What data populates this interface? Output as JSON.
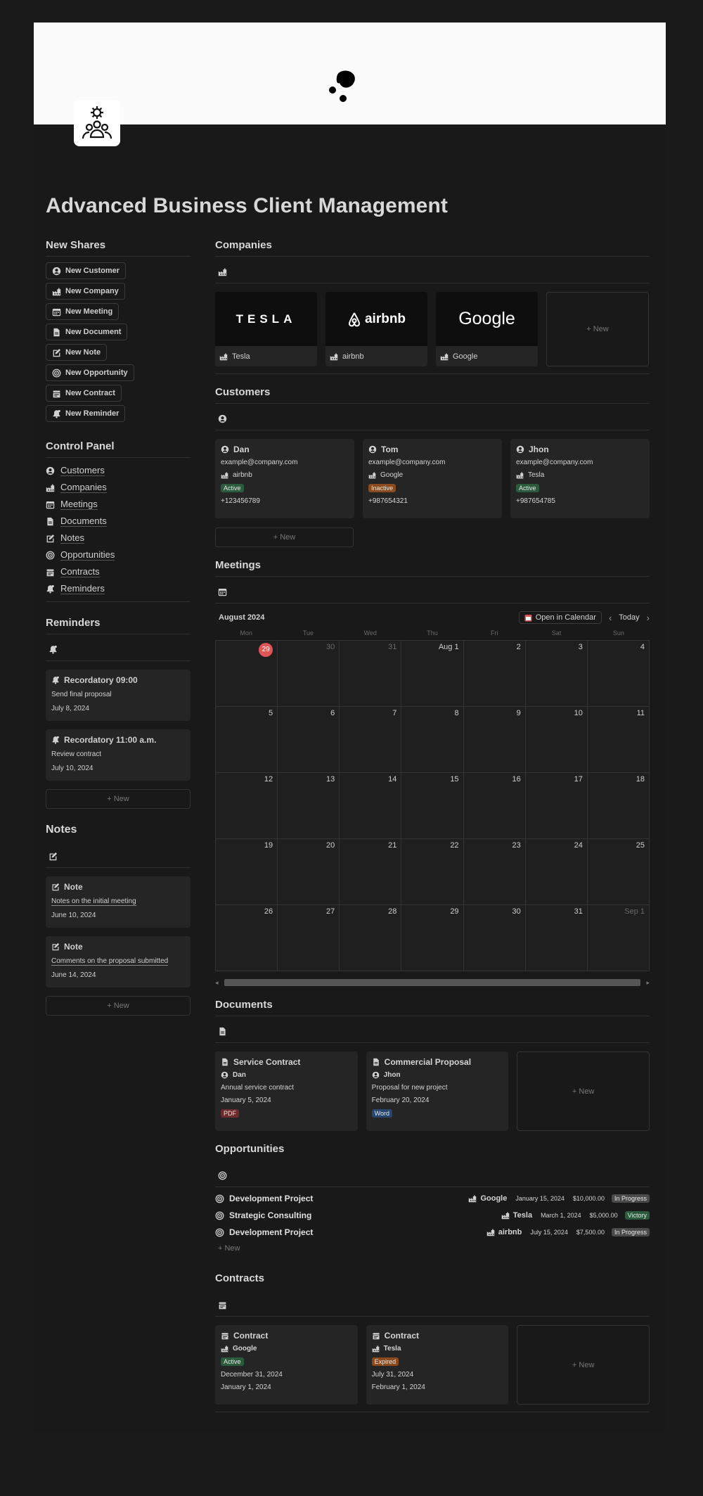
{
  "page": {
    "title": "Advanced Business Client Management"
  },
  "new_shares": {
    "heading": "New Shares",
    "buttons": [
      {
        "label": "New Customer",
        "icon": "person-circle-icon"
      },
      {
        "label": "New Company",
        "icon": "factory-icon"
      },
      {
        "label": "New Meeting",
        "icon": "calendar-icon"
      },
      {
        "label": "New Document",
        "icon": "document-icon"
      },
      {
        "label": "New Note",
        "icon": "note-edit-icon"
      },
      {
        "label": "New Opportunity",
        "icon": "target-icon"
      },
      {
        "label": "New Contract",
        "icon": "contract-icon"
      },
      {
        "label": "New Reminder",
        "icon": "bell-icon"
      }
    ]
  },
  "control_panel": {
    "heading": "Control Panel",
    "items": [
      "Customers",
      "Companies",
      "Meetings",
      "Documents",
      "Notes",
      "Opportunities",
      "Contracts",
      "Reminders"
    ]
  },
  "reminders": {
    "heading": "Reminders",
    "items": [
      {
        "title": "Recordatory 09:00",
        "text": "Send final proposal",
        "date": "July 8, 2024"
      },
      {
        "title": "Recordatory 11:00 a.m.",
        "text": "Review contract",
        "date": "July 10, 2024"
      }
    ],
    "new_label": "New"
  },
  "notes": {
    "heading": "Notes",
    "items": [
      {
        "title": "Note",
        "text": "Notes on the initial meeting",
        "date": "June 10, 2024"
      },
      {
        "title": "Note",
        "text": "Comments on the proposal submitted",
        "date": "June 14, 2024"
      }
    ],
    "new_label": "New"
  },
  "companies": {
    "heading": "Companies",
    "items": [
      {
        "name": "Tesla",
        "logo": "TESLA"
      },
      {
        "name": "airbnb",
        "logo": "airbnb"
      },
      {
        "name": "Google",
        "logo": "Google"
      }
    ],
    "new_label": "New"
  },
  "customers": {
    "heading": "Customers",
    "items": [
      {
        "name": "Dan",
        "email": "example@company.com",
        "company": "airbnb",
        "status": "Active",
        "phone": "+123456789"
      },
      {
        "name": "Tom",
        "email": "example@company.com",
        "company": "Google",
        "status": "Inactive",
        "phone": "+987654321"
      },
      {
        "name": "Jhon",
        "email": "example@company.com",
        "company": "Tesla",
        "status": "Active",
        "phone": "+987654785"
      }
    ],
    "new_label": "New"
  },
  "meetings": {
    "heading": "Meetings",
    "month": "August 2024",
    "open_label": "Open in Calendar",
    "today_label": "Today",
    "days": [
      "Mon",
      "Tue",
      "Wed",
      "Thu",
      "Fri",
      "Sat",
      "Sun"
    ],
    "cells": [
      "29",
      "30",
      "31",
      "Aug 1",
      "2",
      "3",
      "4",
      "5",
      "6",
      "7",
      "8",
      "9",
      "10",
      "11",
      "12",
      "13",
      "14",
      "15",
      "16",
      "17",
      "18",
      "19",
      "20",
      "21",
      "22",
      "23",
      "24",
      "25",
      "26",
      "27",
      "28",
      "29",
      "30",
      "31",
      "Sep 1"
    ]
  },
  "documents": {
    "heading": "Documents",
    "items": [
      {
        "title": "Service Contract",
        "person": "Dan",
        "desc": "Annual service contract",
        "date": "January 5, 2024",
        "type": "PDF"
      },
      {
        "title": "Commercial Proposal",
        "person": "Jhon",
        "desc": "Proposal for new project",
        "date": "February 20, 2024",
        "type": "Word"
      }
    ],
    "new_label": "New"
  },
  "opportunities": {
    "heading": "Opportunities",
    "rows": [
      {
        "name": "Development Project",
        "company": "Google",
        "date": "January 15, 2024",
        "amount": "$10,000.00",
        "status": "In Progress"
      },
      {
        "name": "Strategic Consulting",
        "company": "Tesla",
        "date": "March 1, 2024",
        "amount": "$5,000.00",
        "status": "Victory"
      },
      {
        "name": "Development Project",
        "company": "airbnb",
        "date": "July 15, 2024",
        "amount": "$7,500.00",
        "status": "In Progress"
      }
    ],
    "new_label": "New"
  },
  "contracts": {
    "heading": "Contracts",
    "items": [
      {
        "title": "Contract",
        "company": "Google",
        "status": "Active",
        "end": "December 31, 2024",
        "start": "January 1, 2024"
      },
      {
        "title": "Contract",
        "company": "Tesla",
        "status": "Expired",
        "end": "July 31, 2024",
        "start": "February 1, 2024"
      }
    ],
    "new_label": "New"
  },
  "colors": {
    "active": "#2b5a3c",
    "inactive": "#8a4a1e",
    "today": "#e05555"
  }
}
